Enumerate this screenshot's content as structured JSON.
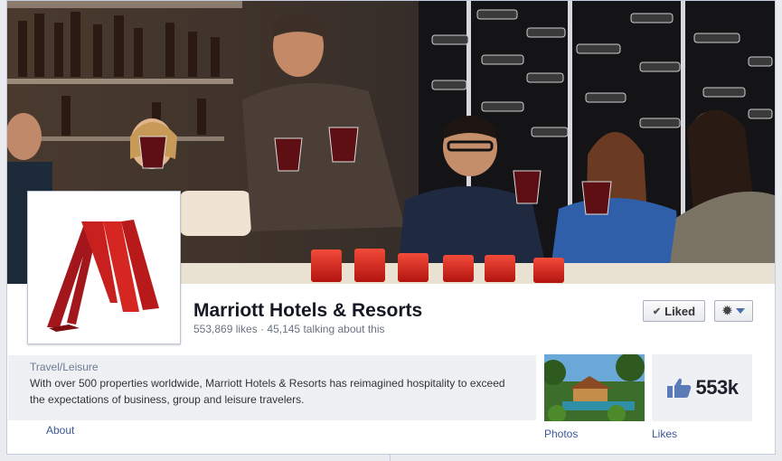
{
  "page": {
    "name": "Marriott Hotels & Resorts",
    "likes_text": "553,869 likes",
    "separator": "·",
    "talking_text": "45,145 talking about this"
  },
  "actions": {
    "liked_label": "Liked",
    "check_icon": "check-icon",
    "gear_icon": "gear-icon"
  },
  "about": {
    "category": "Travel/Leisure",
    "description_line1": "With over 500 properties worldwide, Marriott Hotels & Resorts has reimagined hospitality to exceed",
    "description_line2": "the expectations of business, group and leisure travelers.",
    "link_label": "About"
  },
  "apps": {
    "photos_label": "Photos",
    "likes_count": "553k",
    "likes_label": "Likes"
  },
  "colors": {
    "brand_red": "#c8201f",
    "link_blue": "#3b5998",
    "name_text": "#141823",
    "muted_text": "#6a7180"
  }
}
